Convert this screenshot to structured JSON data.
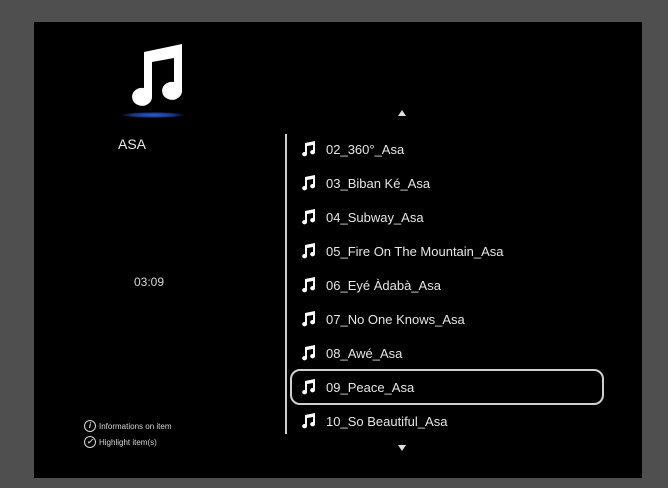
{
  "app": {
    "artist_name": "ASA",
    "duration": "03:09"
  },
  "tracks": [
    {
      "title": "02_360°_Asa",
      "selected": false
    },
    {
      "title": "03_Biban Ké_Asa",
      "selected": false
    },
    {
      "title": "04_Subway_Asa",
      "selected": false
    },
    {
      "title": "05_Fire On The Mountain_Asa",
      "selected": false
    },
    {
      "title": "06_Eyé Àdabà_Asa",
      "selected": false
    },
    {
      "title": "07_No One Knows_Asa",
      "selected": false
    },
    {
      "title": "08_Awé_Asa",
      "selected": false
    },
    {
      "title": "09_Peace_Asa",
      "selected": true
    },
    {
      "title": "10_So Beautiful_Asa",
      "selected": false
    }
  ],
  "legend": {
    "info_label": "Informations on item",
    "highlight_label": "Highlight item(s)"
  },
  "icons": {
    "header": "music-note-icon",
    "track": "music-note-icon",
    "scroll_up": "arrow-up-icon",
    "scroll_down": "arrow-down-icon",
    "info": "info-icon",
    "highlight": "checkmark-icon"
  },
  "colors": {
    "accent_glow": "#2f5fd0",
    "text": "#e6e6e6",
    "background": "#000000"
  }
}
